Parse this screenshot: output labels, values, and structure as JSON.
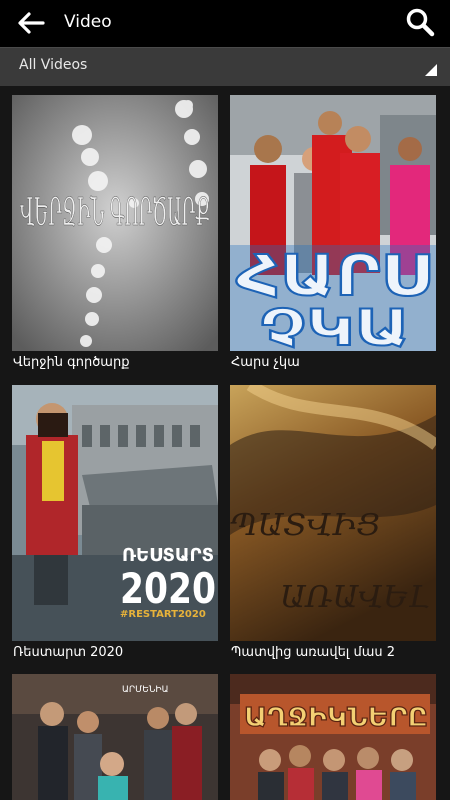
{
  "header": {
    "title": "Video",
    "back_icon": "arrow-left-icon",
    "search_icon": "search-icon"
  },
  "filter": {
    "label": "All Videos",
    "dropdown_icon": "triangle-corner-icon"
  },
  "videos": [
    {
      "title": "Վերջին գործարք",
      "poster_text": "ՎԵՐՋԻՆ ԳՈՐԾԱՐՔ"
    },
    {
      "title": "Հարս չկա",
      "poster_text": "ՀԱՐՍ ՉԿԱ"
    },
    {
      "title": "Ռեստարտ 2020",
      "poster_text": "ՌԵՍՏԱՐՏ 2020",
      "poster_tag": "#RESTART2020"
    },
    {
      "title": "Պատվից առավել մաս 2",
      "poster_text": "ՊԱՏՎԻՑ ԱՌԱՎԵԼ"
    },
    {
      "title": "",
      "poster_text": "ԱՐՄԵՆԻԱ"
    },
    {
      "title": "",
      "poster_text": "ԱՂՋԻԿՆԵՐԸ"
    }
  ]
}
